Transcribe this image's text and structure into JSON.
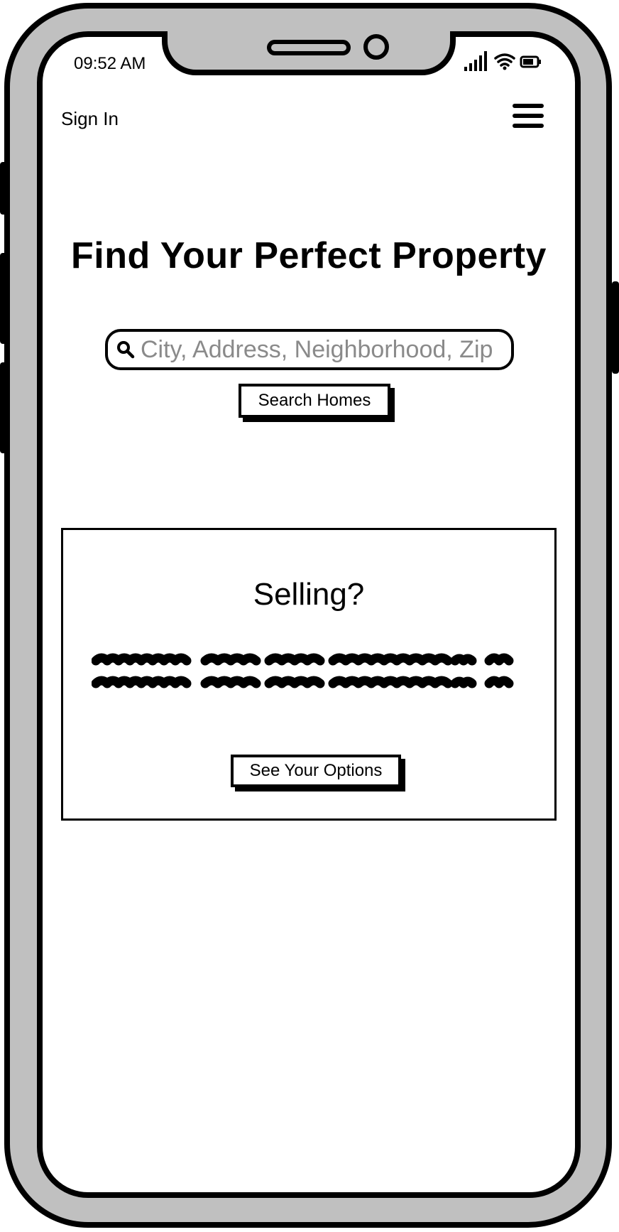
{
  "status_bar": {
    "time": "09:52 AM",
    "icons": [
      "signal-icon",
      "wifi-icon",
      "battery-icon"
    ]
  },
  "header": {
    "sign_in_label": "Sign In",
    "menu_icon": "hamburger-menu-icon"
  },
  "hero": {
    "title": "Find Your Perfect Property",
    "search_placeholder": "City, Address, Neighborhood, Zip",
    "search_icon": "search-icon",
    "search_button_label": "Search Homes"
  },
  "selling_card": {
    "title": "Selling?",
    "body_placeholder": "scribbled-text",
    "button_label": "See Your Options"
  },
  "colors": {
    "frame": "#c0c0c0",
    "outline": "#000000",
    "screen": "#ffffff",
    "placeholder": "#8a8a8a"
  }
}
